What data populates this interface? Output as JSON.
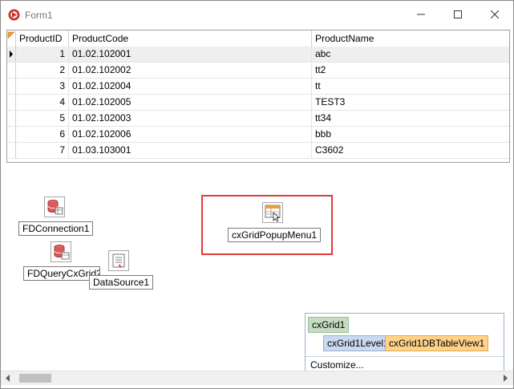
{
  "window": {
    "title": "Form1"
  },
  "grid": {
    "columns": [
      "ProductID",
      "ProductCode",
      "ProductName"
    ],
    "rows": [
      {
        "id": "1",
        "code": "01.02.102001",
        "name": "abc"
      },
      {
        "id": "2",
        "code": "01.02.102002",
        "name": "tt2"
      },
      {
        "id": "3",
        "code": "01.02.102004",
        "name": "tt"
      },
      {
        "id": "4",
        "code": "01.02.102005",
        "name": "TEST3"
      },
      {
        "id": "5",
        "code": "01.02.102003",
        "name": "tt34"
      },
      {
        "id": "6",
        "code": "01.02.102006",
        "name": "bbb"
      },
      {
        "id": "7",
        "code": "01.03.103001",
        "name": "C3602"
      }
    ]
  },
  "components": {
    "fdconnection": "FDConnection1",
    "fdquery": "FDQueryCxGrid2",
    "datasource": "DataSource1",
    "popupmenu": "cxGridPopupMenu1"
  },
  "designer": {
    "grid": "cxGrid1",
    "level": "cxGrid1Level1",
    "view": "cxGrid1DBTableView1",
    "customize": "Customize..."
  },
  "colors": {
    "highlight_border": "#e23a3a",
    "grid_node_bg": "#c5dcc0",
    "level_node_bg": "#c9d9ee",
    "view_node_bg": "#ffd28a"
  }
}
